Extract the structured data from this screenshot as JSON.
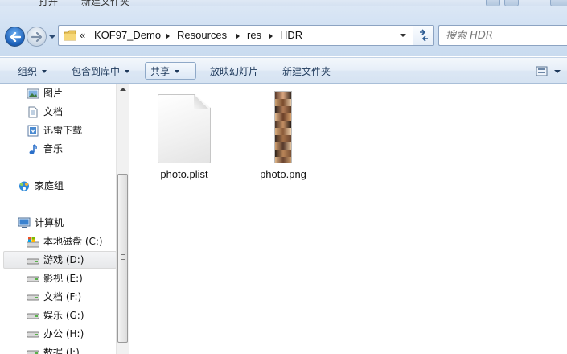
{
  "background_window": {
    "tab1": "打开",
    "tab2": "新建文件夹"
  },
  "navigation": {
    "back_icon": "back-arrow-icon",
    "forward_icon": "forward-arrow-icon",
    "recent_icon": "chevron-down-icon"
  },
  "address": {
    "overflow": "«",
    "crumbs": [
      "KOF97_Demo",
      "Resources",
      "res",
      "HDR"
    ]
  },
  "search": {
    "placeholder": "搜索 HDR"
  },
  "toolbar": {
    "organize": "组织",
    "include_in_library": "包含到库中",
    "share": "共享",
    "slideshow": "放映幻灯片",
    "new_folder": "新建文件夹"
  },
  "sidebar": {
    "items": [
      {
        "label": "图片",
        "icon": "pictures-icon"
      },
      {
        "label": "文档",
        "icon": "documents-icon"
      },
      {
        "label": "迅雷下载",
        "icon": "xunlei-download-icon"
      },
      {
        "label": "音乐",
        "icon": "music-icon"
      },
      {
        "label": "家庭组",
        "icon": "homegroup-icon"
      },
      {
        "label": "计算机",
        "icon": "computer-icon"
      },
      {
        "label": "本地磁盘 (C:)",
        "icon": "system-drive-icon"
      },
      {
        "label": "游戏 (D:)",
        "icon": "drive-icon",
        "selected": true
      },
      {
        "label": "影视 (E:)",
        "icon": "drive-icon"
      },
      {
        "label": "文档 (F:)",
        "icon": "drive-icon"
      },
      {
        "label": "娱乐 (G:)",
        "icon": "drive-icon"
      },
      {
        "label": "办公 (H:)",
        "icon": "drive-icon"
      },
      {
        "label": "数据 (I:)",
        "icon": "drive-icon"
      }
    ]
  },
  "files": [
    {
      "name": "photo.plist",
      "type": "document"
    },
    {
      "name": "photo.png",
      "type": "image"
    }
  ],
  "colors": {
    "toolbar_text": "#1e395b",
    "accent_blue": "#1c5fb8",
    "selected_bg": "#e7e8ea"
  }
}
